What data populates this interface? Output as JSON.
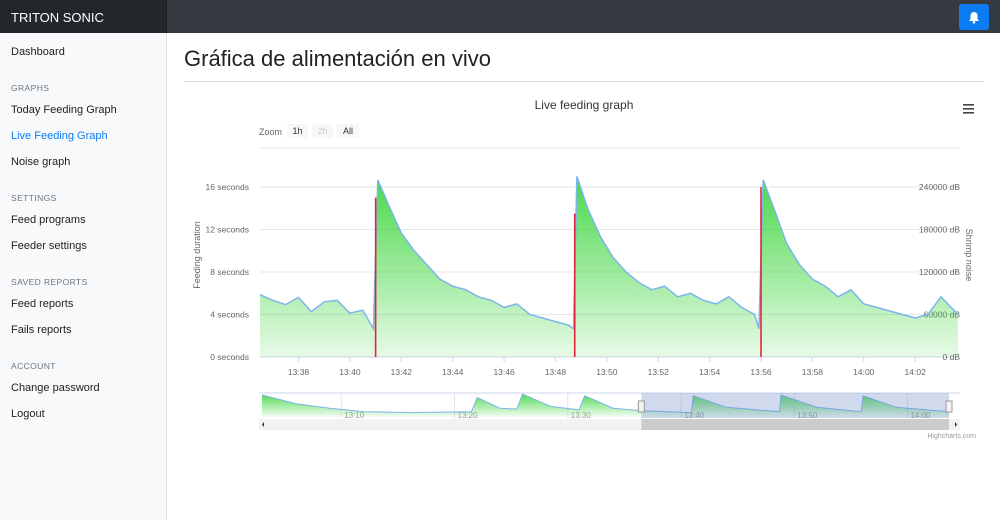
{
  "app": {
    "brand": "TRITON SONIC",
    "notification_icon": "bell-icon",
    "accent": "#0d7cf2"
  },
  "sidebar": {
    "dashboard": "Dashboard",
    "sections": [
      {
        "title": "GRAPHS",
        "items": [
          "Today Feeding Graph",
          "Live Feeding Graph",
          "Noise graph"
        ]
      },
      {
        "title": "SETTINGS",
        "items": [
          "Feed programs",
          "Feeder settings"
        ]
      },
      {
        "title": "SAVED REPORTS",
        "items": [
          "Feed reports",
          "Fails reports"
        ]
      },
      {
        "title": "ACCOUNT",
        "items": [
          "Change password",
          "Logout"
        ]
      }
    ],
    "active": "Live Feeding Graph"
  },
  "page": {
    "title": "Gráfica de alimentación en vivo"
  },
  "chart_data": {
    "type": "area",
    "title": "Live feeding graph",
    "menu_icon": "hamburger-icon",
    "zoom": {
      "label": "Zoom",
      "buttons": [
        "1h",
        "2h",
        "All"
      ],
      "disabled": "2h"
    },
    "y_left": {
      "label": "Feeding duration",
      "ticks": [
        "0 seconds",
        "4 seconds",
        "8 seconds",
        "12 seconds",
        "16 seconds"
      ],
      "range": [
        0,
        16
      ]
    },
    "y_right": {
      "label": "Shrimp noise",
      "ticks": [
        "0 dB",
        "60000 dB",
        "120000 dB",
        "180000 dB",
        "240000 dB"
      ],
      "range": [
        0,
        240000
      ]
    },
    "x_ticks": [
      "13:38",
      "13:40",
      "13:42",
      "13:44",
      "13:46",
      "13:48",
      "13:50",
      "13:52",
      "13:54",
      "13:56",
      "13:58",
      "14:00",
      "14:02"
    ],
    "x_range": [
      "13:36:30",
      "14:03:40"
    ],
    "grid": true,
    "series": [
      {
        "name": "Shrimp noise",
        "type": "area",
        "color": "#7cb5ec",
        "fill": "#3ed63e",
        "data": [
          [
            "13:36:30",
            88000
          ],
          [
            "13:37:00",
            80000
          ],
          [
            "13:37:30",
            74000
          ],
          [
            "13:38:00",
            84000
          ],
          [
            "13:38:30",
            64000
          ],
          [
            "13:39:00",
            78000
          ],
          [
            "13:39:30",
            80000
          ],
          [
            "13:40:00",
            62000
          ],
          [
            "13:40:30",
            66000
          ],
          [
            "13:40:55",
            40000
          ],
          [
            "13:41:05",
            250000
          ],
          [
            "13:41:30",
            215000
          ],
          [
            "13:42:00",
            175000
          ],
          [
            "13:42:30",
            150000
          ],
          [
            "13:43:00",
            130000
          ],
          [
            "13:43:30",
            110000
          ],
          [
            "13:44:00",
            100000
          ],
          [
            "13:44:30",
            95000
          ],
          [
            "13:45:00",
            85000
          ],
          [
            "13:45:30",
            80000
          ],
          [
            "13:46:00",
            70000
          ],
          [
            "13:46:30",
            75000
          ],
          [
            "13:47:00",
            60000
          ],
          [
            "13:47:30",
            55000
          ],
          [
            "13:48:00",
            50000
          ],
          [
            "13:48:30",
            45000
          ],
          [
            "13:48:42",
            40000
          ],
          [
            "13:48:50",
            255000
          ],
          [
            "13:49:15",
            210000
          ],
          [
            "13:49:45",
            170000
          ],
          [
            "13:50:15",
            140000
          ],
          [
            "13:50:45",
            120000
          ],
          [
            "13:51:15",
            105000
          ],
          [
            "13:51:45",
            95000
          ],
          [
            "13:52:15",
            100000
          ],
          [
            "13:52:45",
            85000
          ],
          [
            "13:53:15",
            90000
          ],
          [
            "13:53:45",
            80000
          ],
          [
            "13:54:15",
            75000
          ],
          [
            "13:54:45",
            85000
          ],
          [
            "13:55:15",
            70000
          ],
          [
            "13:55:45",
            60000
          ],
          [
            "13:55:55",
            40000
          ],
          [
            "13:56:05",
            250000
          ],
          [
            "13:56:30",
            210000
          ],
          [
            "13:57:00",
            160000
          ],
          [
            "13:57:30",
            130000
          ],
          [
            "13:58:00",
            110000
          ],
          [
            "13:58:30",
            100000
          ],
          [
            "13:59:00",
            85000
          ],
          [
            "13:59:30",
            95000
          ],
          [
            "14:00:00",
            75000
          ],
          [
            "14:00:30",
            70000
          ],
          [
            "14:01:00",
            65000
          ],
          [
            "14:01:30",
            60000
          ],
          [
            "14:02:00",
            55000
          ],
          [
            "14:02:30",
            60000
          ],
          [
            "14:03:00",
            85000
          ],
          [
            "14:03:40",
            60000
          ]
        ]
      },
      {
        "name": "Feeding duration",
        "type": "column",
        "color": "#e0263a",
        "data": [
          [
            "13:41:00",
            15
          ],
          [
            "13:48:45",
            13.5
          ],
          [
            "13:56:00",
            16
          ]
        ]
      }
    ],
    "navigator": {
      "x_ticks": [
        "13:10",
        "13:20",
        "13:30",
        "13:40",
        "13:50",
        "14:00"
      ],
      "range": [
        "13:03:00",
        "14:03:40"
      ],
      "selected": [
        "13:36:30",
        "14:03:40"
      ],
      "data": [
        [
          "13:03:00",
          250000
        ],
        [
          "13:06:00",
          150000
        ],
        [
          "13:09:00",
          100000
        ],
        [
          "13:12:00",
          60000
        ],
        [
          "13:16:00",
          50000
        ],
        [
          "13:19:00",
          55000
        ],
        [
          "13:21:30",
          60000
        ],
        [
          "13:22:00",
          220000
        ],
        [
          "13:24:00",
          100000
        ],
        [
          "13:25:30",
          90000
        ],
        [
          "13:26:00",
          260000
        ],
        [
          "13:28:30",
          120000
        ],
        [
          "13:31:00",
          80000
        ],
        [
          "13:31:30",
          240000
        ],
        [
          "13:34:00",
          100000
        ],
        [
          "13:36:30",
          70000
        ],
        [
          "13:40:55",
          50000
        ],
        [
          "13:41:05",
          240000
        ],
        [
          "13:44:00",
          110000
        ],
        [
          "13:48:42",
          60000
        ],
        [
          "13:48:50",
          250000
        ],
        [
          "13:52:00",
          110000
        ],
        [
          "13:55:55",
          60000
        ],
        [
          "13:56:05",
          240000
        ],
        [
          "13:59:00",
          110000
        ],
        [
          "14:03:40",
          60000
        ]
      ]
    },
    "credits": "Highcharts.com"
  }
}
